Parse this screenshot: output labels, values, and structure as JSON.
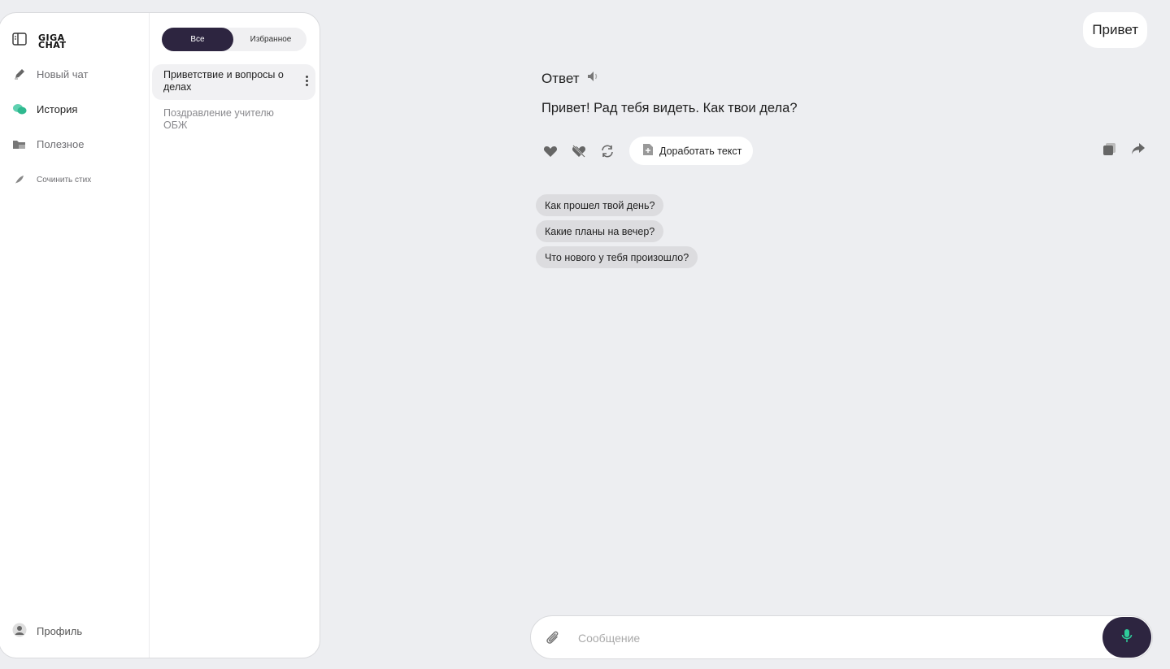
{
  "sidebar": {
    "logo": {
      "line1": "GIGA",
      "line2": "CHAT"
    },
    "nav": [
      {
        "label": "Новый чат",
        "icon": "pencil-icon"
      },
      {
        "label": "История",
        "icon": "chat-bubbles-icon"
      },
      {
        "label": "Полезное",
        "icon": "folder-icon"
      },
      {
        "label": "Сочинить стих",
        "icon": "feather-icon"
      }
    ],
    "profile": {
      "label": "Профиль",
      "icon": "user-icon"
    }
  },
  "history": {
    "tabs": {
      "all": "Все",
      "favorites": "Избранное"
    },
    "chats": [
      {
        "title": "Приветствие и вопросы о делах"
      },
      {
        "title": "Поздравление учителю ОБЖ"
      }
    ]
  },
  "conversation": {
    "user_message": "Привет",
    "answer_title": "Ответ",
    "answer_text": "Привет! Рад тебя видеть. Как твои дела?",
    "refine_label": "Доработать текст",
    "suggestions": [
      "Как прошел твой день?",
      "Какие планы на вечер?",
      "Что нового у тебя произошло?"
    ]
  },
  "composer": {
    "placeholder": "Сообщение"
  },
  "colors": {
    "accent": "#2d2540",
    "mic_icon": "#2ecc9a",
    "background": "#edeef1"
  }
}
